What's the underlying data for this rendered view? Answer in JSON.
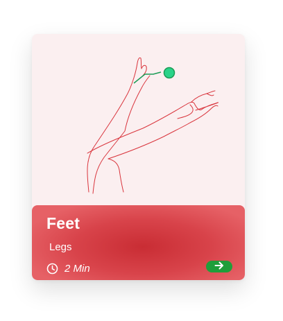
{
  "card": {
    "title": "Feet",
    "category": "Legs",
    "duration": "2 Min"
  },
  "icons": {
    "illustration": "legs-illustration",
    "clock": "clock-icon",
    "arrow": "arrow-right-icon"
  },
  "colors": {
    "card_background": "#fbeff0",
    "panel": "#d8434a",
    "line_art": "#d9343c",
    "marker": "#1fc97a",
    "button": "#1f9e3a",
    "text": "#ffffff"
  }
}
